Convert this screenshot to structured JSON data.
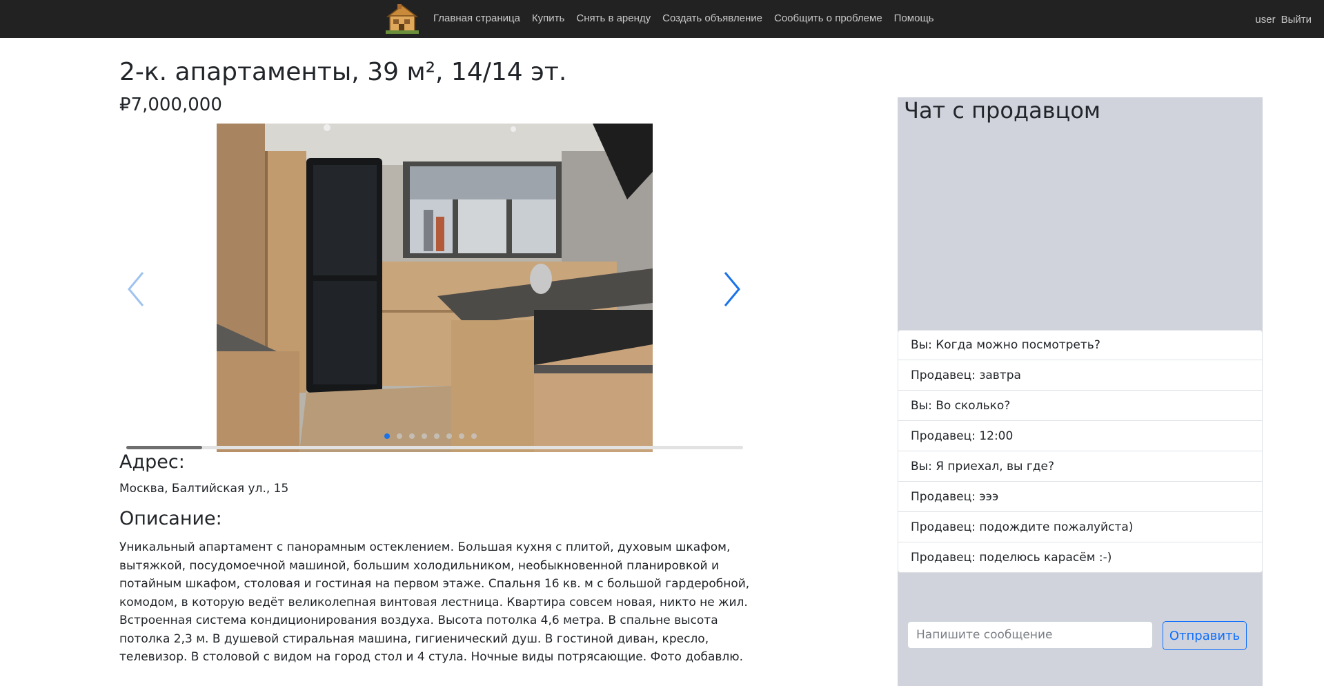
{
  "nav": {
    "links": [
      "Главная страница",
      "Купить",
      "Снять в аренду",
      "Создать объявление",
      "Сообщить о проблеме",
      "Помощь"
    ],
    "user": "user",
    "logout": "Выйти",
    "logo_icon": "house-logo-icon"
  },
  "listing": {
    "title": "2-к. апартаменты, 39 м², 14/14 эт.",
    "price": "₽7,000,000",
    "carousel": {
      "photo_count": 8,
      "active_index": 0
    },
    "address_heading": "Адрес:",
    "address": "Москва, Балтийская ул., 15",
    "description_heading": "Описание:",
    "description": "Уникальный апартамент с панорамным остеклением. Большая кухня с плитой, духовым шкафом, вытяжкой, посудомоечной машиной, большим холодильником, необыкновенной планировкой и потайным шкафом, столовая и гостиная на первом этаже. Спальня 16 кв. м с большой гардеробной, комодом, в которую ведёт великолепная винтовая лестница. Квартира совсем новая, никто не жил. Встроенная система кондиционирования воздуха. Высота потолка 4,6 метра. В спальне высота потолка 2,3 м. В душевой стиральная машина, гигиенический душ. В гостиной диван, кресло, телевизор. В столовой с видом на город стол и 4 стула. Ночные виды потрясающие. Фото добавлю."
  },
  "chat": {
    "title": "Чат с продавцом",
    "messages": [
      "Вы: Когда можно посмотреть?",
      "Продавец: завтра",
      "Вы: Во сколько?",
      "Продавец: 12:00",
      "Вы: Я приехал, вы где?",
      "Продавец: эээ",
      "Продавец: подождите пожалуйста)",
      "Продавец: поделюсь карасём :-)"
    ],
    "input_placeholder": "Напишите сообщение",
    "input_value": "",
    "send_label": "Отправить"
  },
  "colors": {
    "navbar": "#222222",
    "chat_bg": "#d0d3dc",
    "accent": "#0d6efd",
    "carousel_arrow": "#1a73e8"
  }
}
